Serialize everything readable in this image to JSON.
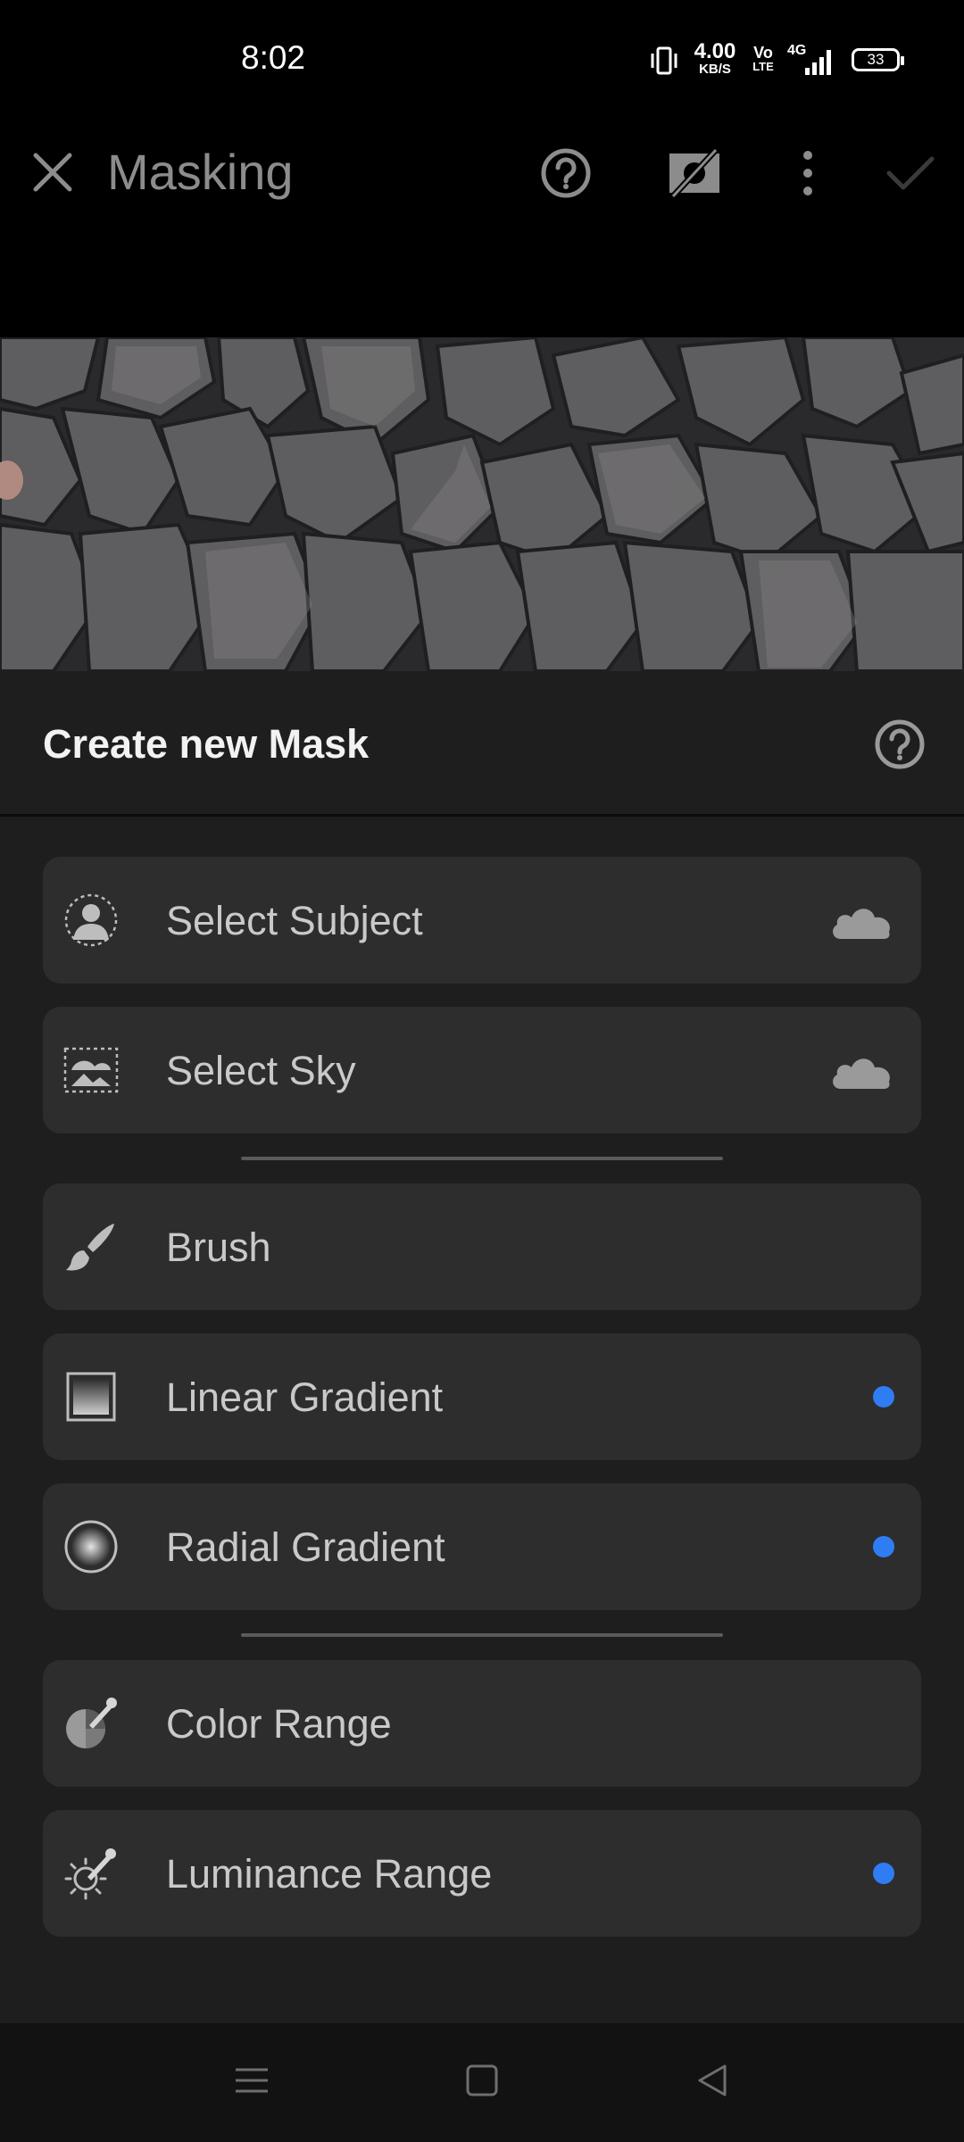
{
  "status_bar": {
    "time": "8:02",
    "network_speed_value": "4.00",
    "network_speed_unit": "KB/S",
    "volte_top": "Vo",
    "volte_bottom": "LTE",
    "network_type": "4G",
    "battery": "33"
  },
  "app_bar": {
    "title": "Masking",
    "icons": [
      "close-icon",
      "help-icon",
      "mask-overlay-off-icon",
      "more-vert-icon",
      "check-icon"
    ]
  },
  "sheet": {
    "title": "Create new Mask",
    "options": [
      {
        "label": "Select Subject",
        "icon": "select-subject-icon",
        "badge": "cloud-icon"
      },
      {
        "label": "Select Sky",
        "icon": "select-sky-icon",
        "badge": "cloud-icon"
      },
      {
        "label": "Brush",
        "icon": "brush-icon",
        "badge": ""
      },
      {
        "label": "Linear Gradient",
        "icon": "linear-gradient-icon",
        "badge": "new-dot"
      },
      {
        "label": "Radial Gradient",
        "icon": "radial-gradient-icon",
        "badge": "new-dot"
      },
      {
        "label": "Color Range",
        "icon": "color-range-icon",
        "badge": ""
      },
      {
        "label": "Luminance Range",
        "icon": "luminance-range-icon",
        "badge": "new-dot"
      }
    ]
  },
  "colors": {
    "accent_dot": "#2f7df5",
    "sheet_bg": "#1e1e1e",
    "option_bg": "#2d2d2d"
  },
  "nav_bar": {
    "icons": [
      "menu-icon",
      "home-icon",
      "back-icon"
    ]
  }
}
